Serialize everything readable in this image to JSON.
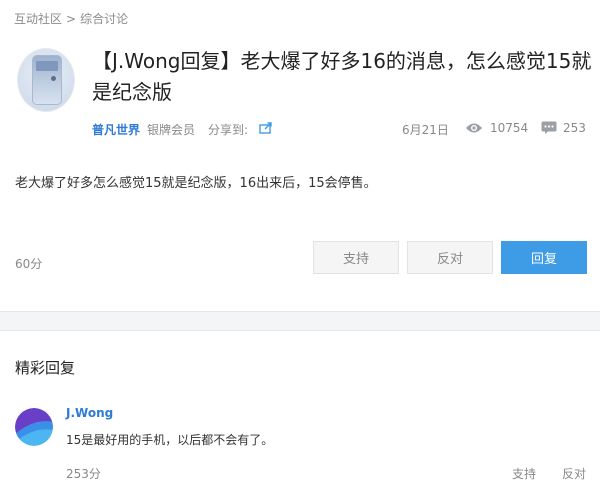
{
  "breadcrumb": {
    "root": "互动社区",
    "separator": ">",
    "current": "综合讨论"
  },
  "post": {
    "title": "【J.Wong回复】老大爆了好多16的消息，怎么感觉15就是纪念版",
    "author": "普凡世界",
    "rank": "银牌会员",
    "share_label": "分享到:",
    "date": "6月21日",
    "views": "10754",
    "comments": "253",
    "body": "老大爆了好多怎么感觉15就是纪念版，16出来后，15会停售。",
    "score": "60分"
  },
  "actions": {
    "support": "支持",
    "oppose": "反对",
    "reply": "回复"
  },
  "highlights": {
    "title": "精彩回复",
    "reply": {
      "author": "J.Wong",
      "text": "15是最好用的手机，以后都不会有了。",
      "score": "253分",
      "support": "支持",
      "oppose": "反对"
    }
  },
  "colors": {
    "accent": "#3e9be6",
    "link": "#2e7bd6",
    "muted": "#888888"
  },
  "icons": [
    "share-icon",
    "eye-icon",
    "comment-icon"
  ]
}
